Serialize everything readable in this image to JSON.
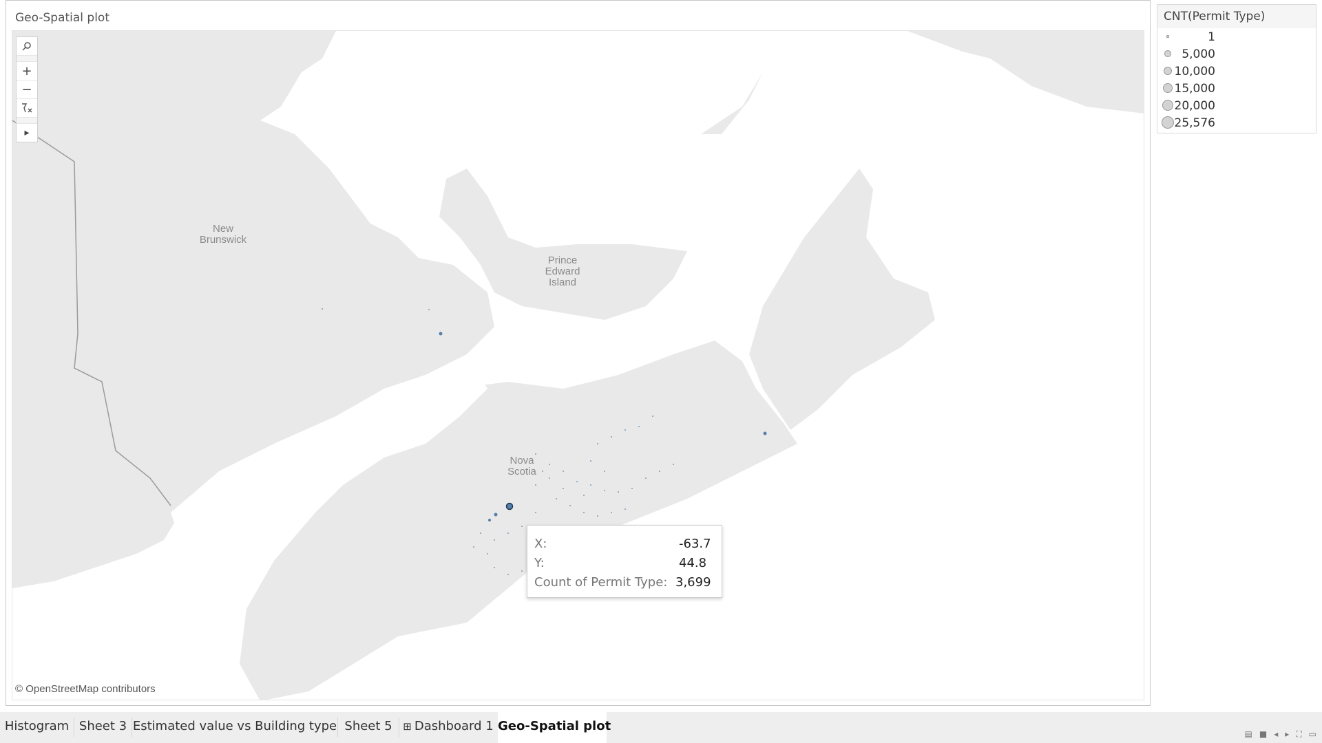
{
  "sheet": {
    "title": "Geo-Spatial plot"
  },
  "map": {
    "place_labels": [
      {
        "name": "New Brunswick",
        "lines": [
          "New",
          "Brunswick"
        ]
      },
      {
        "name": "Prince Edward Island",
        "lines": [
          "Prince",
          "Edward",
          "Island"
        ]
      },
      {
        "name": "Nova Scotia",
        "lines": [
          "Nova",
          "Scotia"
        ]
      }
    ],
    "attribution": "© OpenStreetMap contributors",
    "marker_color": "#4e79a7",
    "land_color": "#e9e9e9",
    "water_color": "#ffffff"
  },
  "toolbar": {
    "search_icon": "search-icon",
    "zoom_in": "+",
    "zoom_out": "−",
    "reset_icon": "reset-map-icon",
    "expand_icon": "▸"
  },
  "tooltip": {
    "x_label": "X:",
    "x_value": "-63.7",
    "y_label": "Y:",
    "y_value": "44.8",
    "count_label": "Count of Permit Type:",
    "count_value": "3,699"
  },
  "legend": {
    "title": "CNT(Permit Type)",
    "items": [
      {
        "label": "1",
        "value": 1
      },
      {
        "label": "5,000",
        "value": 5000
      },
      {
        "label": "10,000",
        "value": 10000
      },
      {
        "label": "15,000",
        "value": 15000
      },
      {
        "label": "20,000",
        "value": 20000
      },
      {
        "label": "25,576",
        "value": 25576
      }
    ]
  },
  "tabs": [
    {
      "label": "Histogram",
      "active": false
    },
    {
      "label": "Sheet 3",
      "active": false
    },
    {
      "label": "Estimated value vs Building type",
      "active": false
    },
    {
      "label": "Sheet 5",
      "active": false
    },
    {
      "label": "Dashboard 1",
      "active": false,
      "icon": "⊞"
    },
    {
      "label": "Geo-Spatial plot",
      "active": true
    }
  ]
}
